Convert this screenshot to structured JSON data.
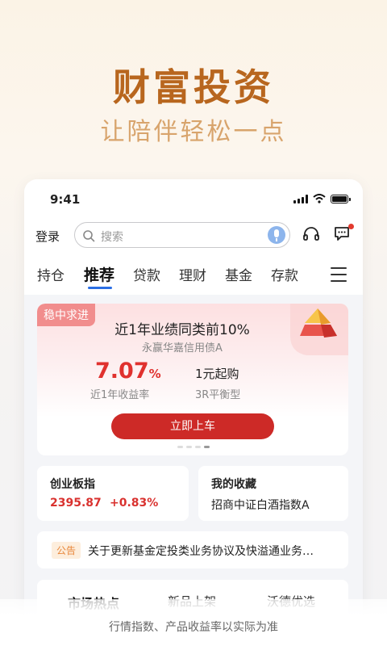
{
  "hero": {
    "title": "财富投资",
    "subtitle": "让陪伴轻松一点"
  },
  "status_bar": {
    "time": "9:41"
  },
  "header": {
    "login_label": "登录",
    "search_placeholder": "搜索"
  },
  "tabs": [
    {
      "label": "持仓",
      "active": false
    },
    {
      "label": "推荐",
      "active": true
    },
    {
      "label": "贷款",
      "active": false
    },
    {
      "label": "理财",
      "active": false
    },
    {
      "label": "基金",
      "active": false
    },
    {
      "label": "存款",
      "active": false
    }
  ],
  "banner": {
    "badge": "稳中求进",
    "headline": "近1年业绩同类前10%",
    "fund_name": "永赢华嘉信用债A",
    "rate_number": "7.07",
    "rate_unit": "%",
    "rate_label": "近1年收益率",
    "min_purchase": "1元起购",
    "risk_level": "3R平衡型",
    "button_label": "立即上车"
  },
  "index_card": {
    "title": "创业板指",
    "value": "2395.87",
    "change": "+0.83%"
  },
  "favorites_card": {
    "title": "我的收藏",
    "item": "招商中证白酒指数A"
  },
  "notice": {
    "tag": "公告",
    "text": "关于更新基金定投类业务协议及快溢通业务…"
  },
  "market_tabs": [
    {
      "label": "市场热点",
      "active": true
    },
    {
      "label": "新品上架",
      "active": false
    },
    {
      "label": "沃德优选",
      "active": false
    }
  ],
  "disclaimer": "行情指数、产品收益率以实际为准",
  "colors": {
    "accent_red": "#cd2a27",
    "brand_orange": "#b8661e",
    "tab_blue": "#2a6ee4"
  }
}
